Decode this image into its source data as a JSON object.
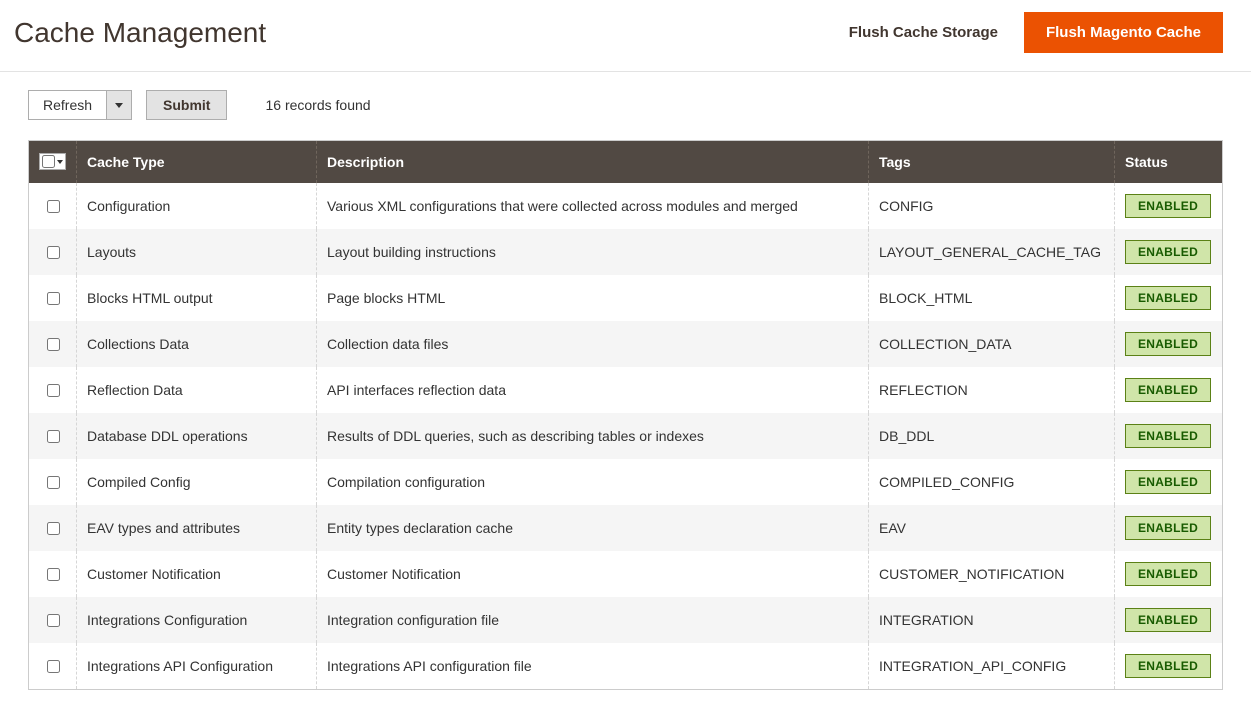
{
  "header": {
    "title": "Cache Management",
    "flush_storage_label": "Flush Cache Storage",
    "flush_magento_label": "Flush Magento Cache"
  },
  "toolbar": {
    "refresh_label": "Refresh",
    "submit_label": "Submit",
    "records_found": "16 records found"
  },
  "table": {
    "headers": {
      "cache_type": "Cache Type",
      "description": "Description",
      "tags": "Tags",
      "status": "Status"
    },
    "rows": [
      {
        "type": "Configuration",
        "description": "Various XML configurations that were collected across modules and merged",
        "tags": "CONFIG",
        "status": "ENABLED"
      },
      {
        "type": "Layouts",
        "description": "Layout building instructions",
        "tags": "LAYOUT_GENERAL_CACHE_TAG",
        "status": "ENABLED"
      },
      {
        "type": "Blocks HTML output",
        "description": "Page blocks HTML",
        "tags": "BLOCK_HTML",
        "status": "ENABLED"
      },
      {
        "type": "Collections Data",
        "description": "Collection data files",
        "tags": "COLLECTION_DATA",
        "status": "ENABLED"
      },
      {
        "type": "Reflection Data",
        "description": "API interfaces reflection data",
        "tags": "REFLECTION",
        "status": "ENABLED"
      },
      {
        "type": "Database DDL operations",
        "description": "Results of DDL queries, such as describing tables or indexes",
        "tags": "DB_DDL",
        "status": "ENABLED"
      },
      {
        "type": "Compiled Config",
        "description": "Compilation configuration",
        "tags": "COMPILED_CONFIG",
        "status": "ENABLED"
      },
      {
        "type": "EAV types and attributes",
        "description": "Entity types declaration cache",
        "tags": "EAV",
        "status": "ENABLED"
      },
      {
        "type": "Customer Notification",
        "description": "Customer Notification",
        "tags": "CUSTOMER_NOTIFICATION",
        "status": "ENABLED"
      },
      {
        "type": "Integrations Configuration",
        "description": "Integration configuration file",
        "tags": "INTEGRATION",
        "status": "ENABLED"
      },
      {
        "type": "Integrations API Configuration",
        "description": "Integrations API configuration file",
        "tags": "INTEGRATION_API_CONFIG",
        "status": "ENABLED"
      }
    ]
  }
}
